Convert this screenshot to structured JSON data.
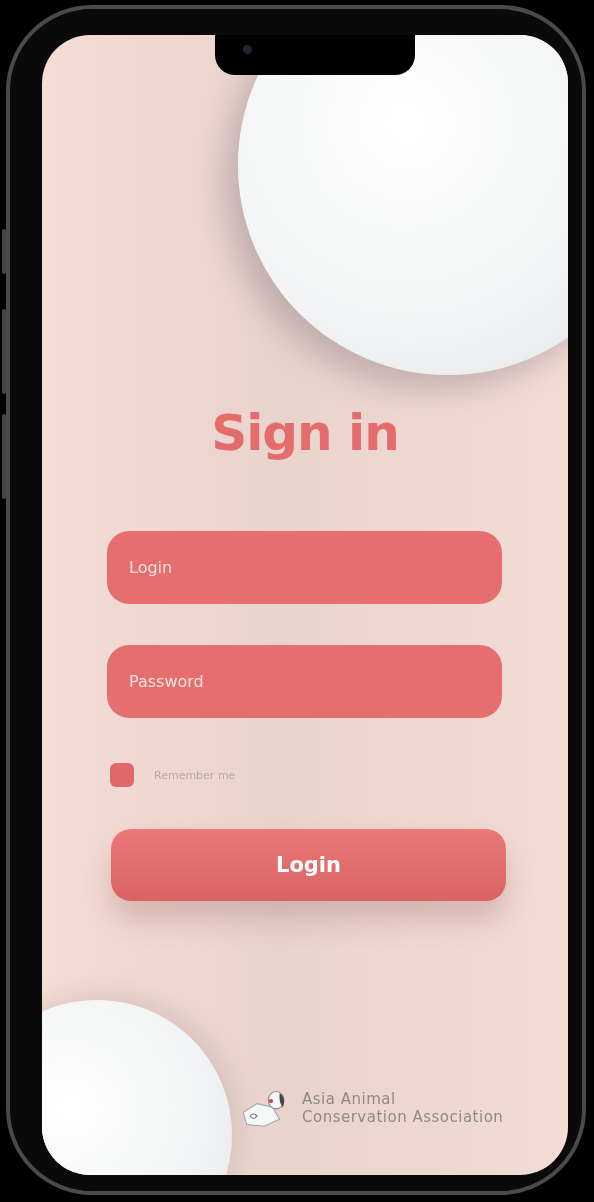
{
  "title": "Sign in",
  "fields": [
    {
      "placeholder": "Login"
    },
    {
      "placeholder": "Password"
    }
  ],
  "remember": {
    "label": "Remember me",
    "checked": false
  },
  "button": "Login",
  "footer": {
    "lines": [
      "Asia Animal",
      "Conservation Association"
    ]
  }
}
